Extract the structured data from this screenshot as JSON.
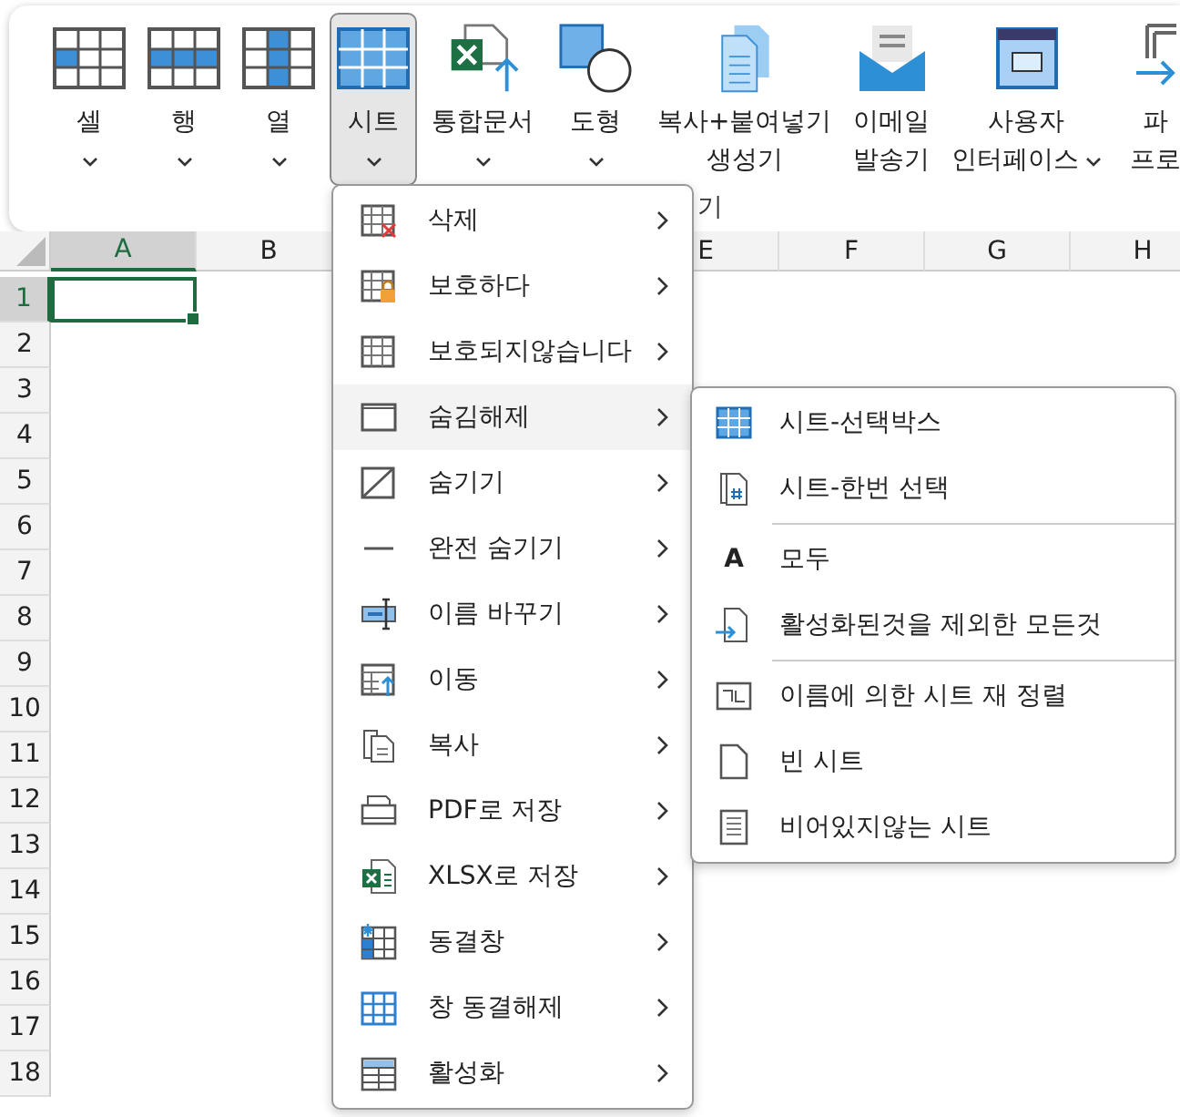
{
  "ribbon": {
    "buttons": [
      {
        "label_lines": [
          "셀"
        ],
        "has_dropdown": true,
        "selected": false
      },
      {
        "label_lines": [
          "행"
        ],
        "has_dropdown": true,
        "selected": false
      },
      {
        "label_lines": [
          "열"
        ],
        "has_dropdown": true,
        "selected": false
      },
      {
        "label_lines": [
          "시트"
        ],
        "has_dropdown": true,
        "selected": true
      },
      {
        "label_lines": [
          "통합문서"
        ],
        "has_dropdown": true,
        "selected": false
      },
      {
        "label_lines": [
          "도형"
        ],
        "has_dropdown": true,
        "selected": false
      },
      {
        "label_lines": [
          "복사+붙여넣기",
          "생성기"
        ],
        "has_dropdown": false,
        "selected": false
      },
      {
        "label_lines": [
          "이메일",
          "발송기"
        ],
        "has_dropdown": false,
        "selected": false
      },
      {
        "label_lines": [
          "사용자",
          "인터페이스"
        ],
        "has_dropdown": true,
        "selected": false
      },
      {
        "label_lines": [
          "파",
          "프로"
        ],
        "has_dropdown": false,
        "selected": false
      }
    ],
    "group_label": "기"
  },
  "sheet": {
    "columns": [
      {
        "label": "A",
        "selected": true
      },
      {
        "label": "B",
        "selected": false
      },
      {
        "label": "E",
        "selected": false
      },
      {
        "label": "F",
        "selected": false
      },
      {
        "label": "G",
        "selected": false
      },
      {
        "label": "H",
        "selected": false
      }
    ],
    "rows": [
      {
        "label": "1",
        "selected": true
      },
      {
        "label": "2",
        "selected": false
      },
      {
        "label": "3",
        "selected": false
      },
      {
        "label": "4",
        "selected": false
      },
      {
        "label": "5",
        "selected": false
      },
      {
        "label": "6",
        "selected": false
      },
      {
        "label": "7",
        "selected": false
      },
      {
        "label": "8",
        "selected": false
      },
      {
        "label": "9",
        "selected": false
      },
      {
        "label": "10",
        "selected": false
      },
      {
        "label": "11",
        "selected": false
      },
      {
        "label": "12",
        "selected": false
      },
      {
        "label": "13",
        "selected": false
      },
      {
        "label": "14",
        "selected": false
      },
      {
        "label": "15",
        "selected": false
      },
      {
        "label": "16",
        "selected": false
      },
      {
        "label": "17",
        "selected": false
      },
      {
        "label": "18",
        "selected": false
      }
    ]
  },
  "menu": {
    "items": [
      {
        "label": "삭제",
        "selected": false
      },
      {
        "label": "보호하다",
        "selected": false
      },
      {
        "label": "보호되지않습니다",
        "selected": false
      },
      {
        "label": "숨김해제",
        "selected": true
      },
      {
        "label": "숨기기",
        "selected": false
      },
      {
        "label": "완전 숨기기",
        "selected": false
      },
      {
        "label": "이름 바꾸기",
        "selected": false
      },
      {
        "label": "이동",
        "selected": false
      },
      {
        "label": "복사",
        "selected": false
      },
      {
        "label": "PDF로 저장",
        "selected": false
      },
      {
        "label": "XLSX로 저장",
        "selected": false
      },
      {
        "label": "동결창",
        "selected": false
      },
      {
        "label": "창 동결해제",
        "selected": false
      },
      {
        "label": "활성화",
        "selected": false
      }
    ]
  },
  "submenu": {
    "items": [
      {
        "label": "시트-선택박스",
        "separator_after": false
      },
      {
        "label": "시트-한번 선택",
        "separator_after": true
      },
      {
        "label": "모두",
        "icon_text": "A",
        "separator_after": false
      },
      {
        "label": "활성화된것을 제외한 모든것",
        "separator_after": true
      },
      {
        "label": "이름에 의한 시트 재 정렬",
        "separator_after": false
      },
      {
        "label": "빈 시트",
        "separator_after": false
      },
      {
        "label": "비어있지않는 시트",
        "separator_after": false
      }
    ]
  }
}
